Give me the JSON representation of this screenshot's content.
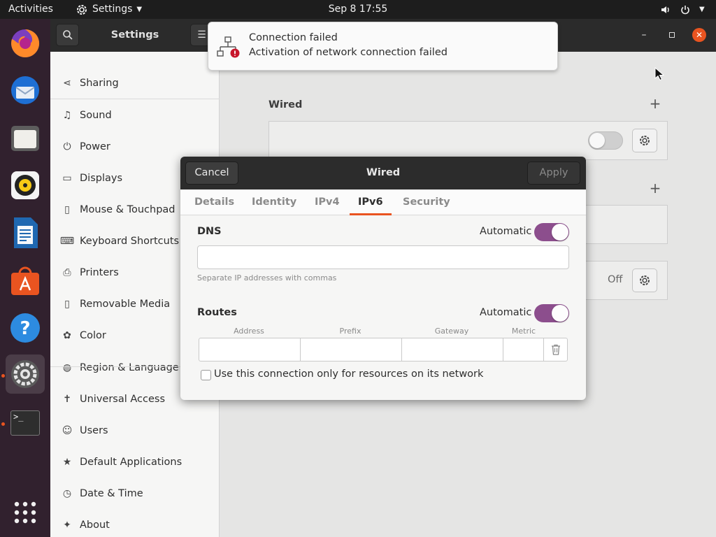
{
  "topbar": {
    "activities": "Activities",
    "app_menu": "Settings",
    "datetime": "Sep 8  17:55"
  },
  "dock": {
    "items": [
      {
        "name": "firefox"
      },
      {
        "name": "thunderbird"
      },
      {
        "name": "files"
      },
      {
        "name": "rhythmbox"
      },
      {
        "name": "libreoffice-writer"
      },
      {
        "name": "ubuntu-software"
      },
      {
        "name": "help"
      },
      {
        "name": "settings",
        "active": true
      },
      {
        "name": "terminal",
        "running": true
      }
    ],
    "terminal_prompt": ">_"
  },
  "window": {
    "title": "Settings"
  },
  "sidebar": {
    "items": [
      {
        "label": "Sharing",
        "icon": "share-icon"
      },
      {
        "label": "Sound",
        "icon": "music-note-icon"
      },
      {
        "label": "Power",
        "icon": "power-icon"
      },
      {
        "label": "Displays",
        "icon": "display-icon"
      },
      {
        "label": "Mouse & Touchpad",
        "icon": "mouse-icon"
      },
      {
        "label": "Keyboard Shortcuts",
        "icon": "keyboard-icon"
      },
      {
        "label": "Printers",
        "icon": "printer-icon"
      },
      {
        "label": "Removable Media",
        "icon": "removable-media-icon"
      },
      {
        "label": "Color",
        "icon": "color-icon"
      },
      {
        "label": "Region & Language",
        "icon": "globe-icon"
      },
      {
        "label": "Universal Access",
        "icon": "accessibility-icon"
      },
      {
        "label": "Users",
        "icon": "users-icon"
      },
      {
        "label": "Default Applications",
        "icon": "star-icon"
      },
      {
        "label": "Date & Time",
        "icon": "clock-icon"
      },
      {
        "label": "About",
        "icon": "about-icon"
      }
    ]
  },
  "main": {
    "wired_heading": "Wired",
    "vpn_status": "Off"
  },
  "notification": {
    "title": "Connection failed",
    "body": "Activation of network connection failed"
  },
  "dialog": {
    "title": "Wired",
    "cancel": "Cancel",
    "apply": "Apply",
    "tabs": [
      "Details",
      "Identity",
      "IPv4",
      "IPv6",
      "Security"
    ],
    "selected_tab": "IPv6",
    "dns_label": "DNS",
    "dns_automatic_label": "Automatic",
    "dns_automatic": true,
    "dns_value": "",
    "dns_hint": "Separate IP addresses with commas",
    "routes_label": "Routes",
    "routes_automatic_label": "Automatic",
    "routes_automatic": true,
    "route_columns": [
      "Address",
      "Prefix",
      "Gateway",
      "Metric"
    ],
    "local_only_label": "Use this connection only for resources on its network",
    "local_only_checked": false
  },
  "colors": {
    "accent": "#e95420",
    "toggle_on": "#8c4e8d",
    "dock_bg": "#31212e",
    "topbar_bg": "#1d1d1d"
  }
}
